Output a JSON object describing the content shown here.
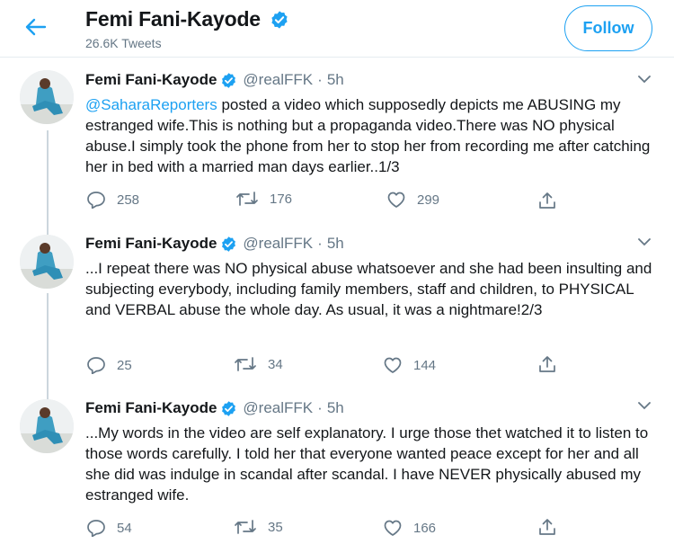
{
  "header": {
    "name": "Femi Fani-Kayode",
    "tweet_count": "26.6K Tweets",
    "follow_label": "Follow"
  },
  "colors": {
    "accent": "#1da1f2",
    "text": "#14171a",
    "muted": "#657786",
    "border": "#e6ecf0"
  },
  "tweets": [
    {
      "name": "Femi Fani-Kayode",
      "handle": "@realFFK",
      "dot": "·",
      "time": "5h",
      "mention": "@SaharaReporters",
      "text": " posted a video which supposedly depicts me ABUSING my estranged wife.This is nothing but a propaganda video.There was NO physical abuse.I simply took the phone from her to stop her from recording me after catching her in bed with a married man days earlier..1/3",
      "replies": "258",
      "retweets": "176",
      "likes": "299"
    },
    {
      "name": "Femi Fani-Kayode",
      "handle": "@realFFK",
      "dot": "·",
      "time": "5h",
      "text": "...I repeat there was NO physical abuse whatsoever and she had been insulting and subjecting everybody, including family members, staff and children, to  PHYSICAL and VERBAL abuse the whole day. As usual, it was a nightmare!2/3",
      "replies": "25",
      "retweets": "34",
      "likes": "144"
    },
    {
      "name": "Femi Fani-Kayode",
      "handle": "@realFFK",
      "dot": "·",
      "time": "5h",
      "text": "...My words in the video are self explanatory. I urge those thet watched it to listen to those words carefully. I told her that everyone wanted peace except for her and all she did was indulge in scandal after scandal. I have NEVER physically abused my estranged wife.",
      "replies": "54",
      "retweets": "35",
      "likes": "166"
    }
  ],
  "icons": {
    "back": "arrow-left-icon",
    "verified": "verified-badge-icon",
    "caret": "chevron-down-icon",
    "reply": "reply-icon",
    "retweet": "retweet-icon",
    "like": "heart-icon",
    "share": "share-icon"
  }
}
